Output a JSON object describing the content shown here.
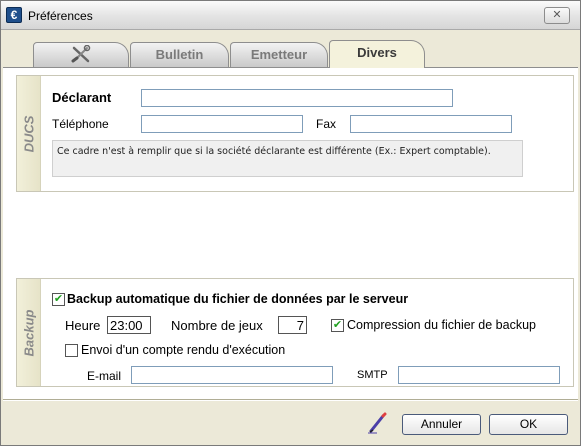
{
  "window": {
    "title": "Préférences",
    "close_glyph": "✕",
    "app_icon": "app-logo-icon"
  },
  "tabs": [
    {
      "label": "",
      "icon": "settings-tools-icon",
      "active": false
    },
    {
      "label": "Bulletin",
      "active": false
    },
    {
      "label": "Emetteur",
      "active": false
    },
    {
      "label": "Divers",
      "active": true
    }
  ],
  "ducs": {
    "section_title": "DUCS",
    "declarant_label": "Déclarant",
    "declarant_value": "",
    "telephone_label": "Téléphone",
    "telephone_value": "",
    "fax_label": "Fax",
    "fax_value": "",
    "note": "Ce cadre n'est à remplir que si la société déclarante est différente (Ex.: Expert comptable)."
  },
  "backup": {
    "section_title": "Backup",
    "auto_backup_label": "Backup automatique du fichier de données par le serveur",
    "auto_backup_checked": true,
    "heure_label": "Heure",
    "heure_value": "23:00",
    "nb_jeux_label": "Nombre de jeux",
    "nb_jeux_value": "7",
    "compression_label": "Compression du fichier de backup",
    "compression_checked": true,
    "envoi_label": "Envoi d'un compte rendu d'exécution",
    "envoi_checked": false,
    "email_label": "E-mail",
    "email_value": "",
    "smtp_label": "SMTP",
    "smtp_value": ""
  },
  "footer": {
    "cancel_label": "Annuler",
    "ok_label": "OK",
    "edit_icon": "pen-icon"
  },
  "colors": {
    "check_mark": "#21a121",
    "section_band": "#f2f0da",
    "input_border": "#7f9db9"
  }
}
